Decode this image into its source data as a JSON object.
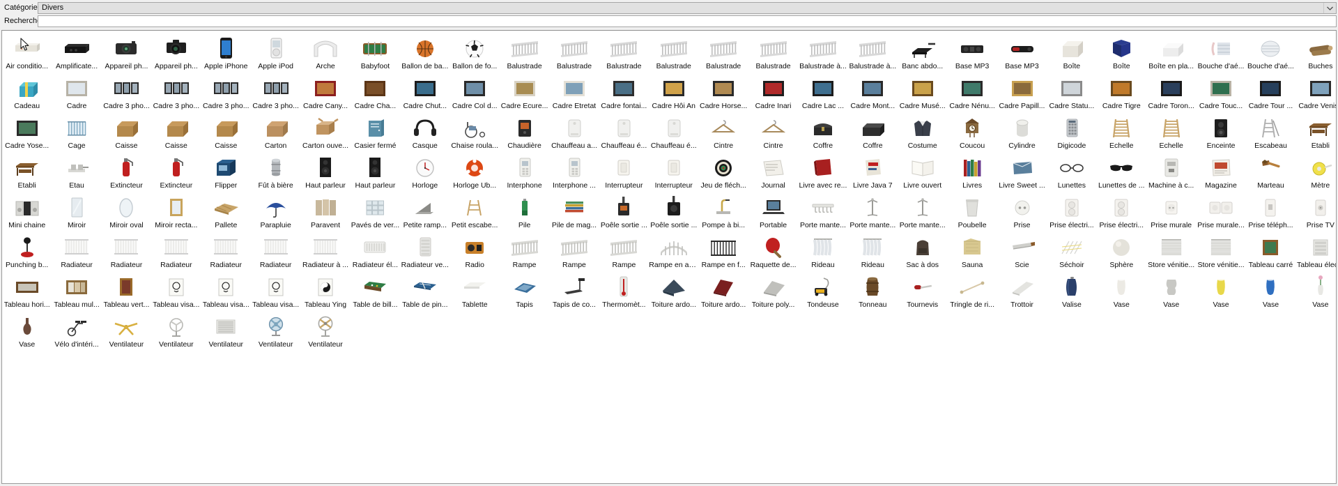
{
  "form": {
    "category_label": "Catégorie:",
    "category_value": "Divers",
    "category_arrow_icon": "chevron-down-icon",
    "search_label": "Recherche:",
    "search_value": "",
    "search_placeholder": ""
  },
  "grid": {
    "columns": 27,
    "items": [
      {
        "label": "Air conditio...",
        "icon": "air-conditioner"
      },
      {
        "label": "Amplificate...",
        "icon": "amplifier"
      },
      {
        "label": "Appareil ph...",
        "icon": "compact-camera"
      },
      {
        "label": "Appareil ph...",
        "icon": "dslr-camera"
      },
      {
        "label": "Apple iPhone",
        "icon": "iphone"
      },
      {
        "label": "Apple iPod",
        "icon": "ipod"
      },
      {
        "label": "Arche",
        "icon": "arch"
      },
      {
        "label": "Babyfoot",
        "icon": "foosball"
      },
      {
        "label": "Ballon de ba...",
        "icon": "basketball"
      },
      {
        "label": "Ballon de fo...",
        "icon": "soccerball"
      },
      {
        "label": "Balustrade",
        "icon": "railing"
      },
      {
        "label": "Balustrade",
        "icon": "railing"
      },
      {
        "label": "Balustrade",
        "icon": "railing"
      },
      {
        "label": "Balustrade",
        "icon": "railing"
      },
      {
        "label": "Balustrade",
        "icon": "railing"
      },
      {
        "label": "Balustrade",
        "icon": "railing"
      },
      {
        "label": "Balustrade à...",
        "icon": "railing"
      },
      {
        "label": "Balustrade à...",
        "icon": "railing"
      },
      {
        "label": "Banc abdo...",
        "icon": "bench"
      },
      {
        "label": "Base MP3",
        "icon": "mp3-dock"
      },
      {
        "label": "Base MP3",
        "icon": "mp3-dock-red"
      },
      {
        "label": "Boîte",
        "icon": "box-white"
      },
      {
        "label": "Boîte",
        "icon": "box-blue"
      },
      {
        "label": "Boîte en pla...",
        "icon": "plastic-box"
      },
      {
        "label": "Bouche d'aé...",
        "icon": "air-vent"
      },
      {
        "label": "Bouche d'aé...",
        "icon": "air-vent-round"
      },
      {
        "label": "Buches",
        "icon": "logs"
      },
      {
        "label": "Cadeau",
        "icon": "gift"
      },
      {
        "label": "Cadre",
        "icon": "frame-plain"
      },
      {
        "label": "Cadre 3 pho...",
        "icon": "frame-triple"
      },
      {
        "label": "Cadre 3 pho...",
        "icon": "frame-triple"
      },
      {
        "label": "Cadre 3 pho...",
        "icon": "frame-triple"
      },
      {
        "label": "Cadre 3 pho...",
        "icon": "frame-triple"
      },
      {
        "label": "Cadre Cany...",
        "icon": "frame-canyon"
      },
      {
        "label": "Cadre Cha...",
        "icon": "frame-brown"
      },
      {
        "label": "Cadre Chut...",
        "icon": "frame-falls"
      },
      {
        "label": "Cadre Col d...",
        "icon": "frame-pass"
      },
      {
        "label": "Cadre Ecure...",
        "icon": "frame-squirrel"
      },
      {
        "label": "Cadre Etretat",
        "icon": "frame-etretat"
      },
      {
        "label": "Cadre fontai...",
        "icon": "frame-fountain"
      },
      {
        "label": "Cadre Hôi An",
        "icon": "frame-hoian"
      },
      {
        "label": "Cadre Horse...",
        "icon": "frame-horse"
      },
      {
        "label": "Cadre Inari",
        "icon": "frame-inari"
      },
      {
        "label": "Cadre Lac ...",
        "icon": "frame-lake"
      },
      {
        "label": "Cadre Mont...",
        "icon": "frame-mountain"
      },
      {
        "label": "Cadre Musé...",
        "icon": "frame-museum"
      },
      {
        "label": "Cadre Nénu...",
        "icon": "frame-lily"
      },
      {
        "label": "Cadre Papill...",
        "icon": "frame-butterfly"
      },
      {
        "label": "Cadre Statu...",
        "icon": "frame-statue"
      },
      {
        "label": "Cadre Tigre",
        "icon": "frame-tiger"
      },
      {
        "label": "Cadre Toron...",
        "icon": "frame-toronto"
      },
      {
        "label": "Cadre Touc...",
        "icon": "frame-toucan"
      },
      {
        "label": "Cadre Tour ...",
        "icon": "frame-tower"
      },
      {
        "label": "Cadre Venise",
        "icon": "frame-venice"
      },
      {
        "label": "Cadre Yose...",
        "icon": "frame-yosemite"
      },
      {
        "label": "Cage",
        "icon": "cage"
      },
      {
        "label": "Caisse",
        "icon": "crate"
      },
      {
        "label": "Caisse",
        "icon": "crate"
      },
      {
        "label": "Caisse",
        "icon": "crate"
      },
      {
        "label": "Carton",
        "icon": "carton"
      },
      {
        "label": "Carton ouve...",
        "icon": "carton-open"
      },
      {
        "label": "Casier fermé",
        "icon": "locker"
      },
      {
        "label": "Casque",
        "icon": "headphones"
      },
      {
        "label": "Chaise roula...",
        "icon": "wheelchair"
      },
      {
        "label": "Chaudière",
        "icon": "boiler"
      },
      {
        "label": "Chauffeau a...",
        "icon": "water-heater"
      },
      {
        "label": "Chauffeau é...",
        "icon": "water-heater"
      },
      {
        "label": "Chauffeau é...",
        "icon": "water-heater"
      },
      {
        "label": "Cintre",
        "icon": "hanger"
      },
      {
        "label": "Cintre",
        "icon": "hanger"
      },
      {
        "label": "Coffre",
        "icon": "chest"
      },
      {
        "label": "Coffre",
        "icon": "chest-dark"
      },
      {
        "label": "Costume",
        "icon": "suit"
      },
      {
        "label": "Coucou",
        "icon": "cuckoo-clock"
      },
      {
        "label": "Cylindre",
        "icon": "cylinder"
      },
      {
        "label": "Digicode",
        "icon": "keypad"
      },
      {
        "label": "Echelle",
        "icon": "ladder"
      },
      {
        "label": "Echelle",
        "icon": "ladder"
      },
      {
        "label": "Enceinte",
        "icon": "speaker"
      },
      {
        "label": "Escabeau",
        "icon": "stepladder"
      },
      {
        "label": "Etabli",
        "icon": "workbench"
      },
      {
        "label": "Etabli",
        "icon": "workbench"
      },
      {
        "label": "Etau",
        "icon": "vise"
      },
      {
        "label": "Extincteur",
        "icon": "extinguisher"
      },
      {
        "label": "Extincteur",
        "icon": "extinguisher"
      },
      {
        "label": "Flipper",
        "icon": "pinball"
      },
      {
        "label": "Fût à bière",
        "icon": "keg"
      },
      {
        "label": "Haut parleur",
        "icon": "loudspeaker"
      },
      {
        "label": "Haut parleur",
        "icon": "loudspeaker"
      },
      {
        "label": "Horloge",
        "icon": "clock"
      },
      {
        "label": "Horloge Ub...",
        "icon": "clock-ubuntu"
      },
      {
        "label": "Interphone",
        "icon": "intercom"
      },
      {
        "label": "Interphone ...",
        "icon": "intercom"
      },
      {
        "label": "Interrupteur",
        "icon": "switch"
      },
      {
        "label": "Interrupteur",
        "icon": "switch"
      },
      {
        "label": "Jeu de fléch...",
        "icon": "darts"
      },
      {
        "label": "Journal",
        "icon": "newspaper"
      },
      {
        "label": "Livre avec re...",
        "icon": "book-red"
      },
      {
        "label": "Livre Java 7",
        "icon": "book-java"
      },
      {
        "label": "Livre ouvert",
        "icon": "book-open"
      },
      {
        "label": "Livres",
        "icon": "books"
      },
      {
        "label": "Livre Sweet ...",
        "icon": "book-sweet"
      },
      {
        "label": "Lunettes",
        "icon": "glasses"
      },
      {
        "label": "Lunettes de ...",
        "icon": "sunglasses"
      },
      {
        "label": "Machine à c...",
        "icon": "coffee-machine"
      },
      {
        "label": "Magazine",
        "icon": "magazine"
      },
      {
        "label": "Marteau",
        "icon": "hammer"
      },
      {
        "label": "Mètre",
        "icon": "tape-measure"
      },
      {
        "label": "Mini chaine",
        "icon": "stereo"
      },
      {
        "label": "Miroir",
        "icon": "mirror"
      },
      {
        "label": "Miroir oval",
        "icon": "mirror-oval"
      },
      {
        "label": "Miroir recta...",
        "icon": "mirror-rect"
      },
      {
        "label": "Pallete",
        "icon": "pallet"
      },
      {
        "label": "Parapluie",
        "icon": "umbrella"
      },
      {
        "label": "Paravent",
        "icon": "screen-divider"
      },
      {
        "label": "Pavés de ver...",
        "icon": "glass-blocks"
      },
      {
        "label": "Petite ramp...",
        "icon": "small-ramp"
      },
      {
        "label": "Petit escabe...",
        "icon": "small-stepladder"
      },
      {
        "label": "Pile",
        "icon": "battery"
      },
      {
        "label": "Pile de mag...",
        "icon": "magazine-stack"
      },
      {
        "label": "Poêle sortie ...",
        "icon": "stove"
      },
      {
        "label": "Poêle sortie ...",
        "icon": "stove-dark"
      },
      {
        "label": "Pompe à bi...",
        "icon": "beer-pump"
      },
      {
        "label": "Portable",
        "icon": "laptop"
      },
      {
        "label": "Porte mante...",
        "icon": "coat-rack-wall"
      },
      {
        "label": "Porte mante...",
        "icon": "coat-rack-stand"
      },
      {
        "label": "Porte mante...",
        "icon": "coat-rack-stand"
      },
      {
        "label": "Poubelle",
        "icon": "trash-bin"
      },
      {
        "label": "Prise",
        "icon": "socket"
      },
      {
        "label": "Prise électri...",
        "icon": "power-socket"
      },
      {
        "label": "Prise électri...",
        "icon": "power-socket"
      },
      {
        "label": "Prise murale",
        "icon": "wall-socket"
      },
      {
        "label": "Prise murale...",
        "icon": "wall-socket-double"
      },
      {
        "label": "Prise téléph...",
        "icon": "phone-socket"
      },
      {
        "label": "Prise TV",
        "icon": "tv-socket"
      },
      {
        "label": "Punching b...",
        "icon": "punching-ball"
      },
      {
        "label": "Radiateur",
        "icon": "radiator"
      },
      {
        "label": "Radiateur",
        "icon": "radiator"
      },
      {
        "label": "Radiateur",
        "icon": "radiator"
      },
      {
        "label": "Radiateur",
        "icon": "radiator"
      },
      {
        "label": "Radiateur",
        "icon": "radiator"
      },
      {
        "label": "Radiateur à ...",
        "icon": "radiator"
      },
      {
        "label": "Radiateur él...",
        "icon": "radiator-electric"
      },
      {
        "label": "Radiateur ve...",
        "icon": "radiator-vertical"
      },
      {
        "label": "Radio",
        "icon": "radio"
      },
      {
        "label": "Rampe",
        "icon": "ramp-rail"
      },
      {
        "label": "Rampe",
        "icon": "ramp-rail"
      },
      {
        "label": "Rampe",
        "icon": "ramp-rail"
      },
      {
        "label": "Rampe en an...",
        "icon": "ramp-curved"
      },
      {
        "label": "Rampe en f...",
        "icon": "ramp-iron"
      },
      {
        "label": "Raquette de...",
        "icon": "ping-pong-paddle"
      },
      {
        "label": "Rideau",
        "icon": "curtain"
      },
      {
        "label": "Rideau",
        "icon": "curtain"
      },
      {
        "label": "Sac à dos",
        "icon": "backpack"
      },
      {
        "label": "Sauna",
        "icon": "sauna"
      },
      {
        "label": "Scie",
        "icon": "saw"
      },
      {
        "label": "Séchoir",
        "icon": "drying-rack"
      },
      {
        "label": "Sphère",
        "icon": "sphere"
      },
      {
        "label": "Store vénitie...",
        "icon": "venetian-blind"
      },
      {
        "label": "Store vénitie...",
        "icon": "venetian-blind"
      },
      {
        "label": "Tableau carré",
        "icon": "painting-square"
      },
      {
        "label": "Tableau élec...",
        "icon": "electrical-panel"
      },
      {
        "label": "Tableau hori...",
        "icon": "painting-horizontal"
      },
      {
        "label": "Tableau mul...",
        "icon": "painting-multi"
      },
      {
        "label": "Tableau vert...",
        "icon": "painting-vertical"
      },
      {
        "label": "Tableau visa...",
        "icon": "painting-face"
      },
      {
        "label": "Tableau visa...",
        "icon": "painting-face"
      },
      {
        "label": "Tableau visa...",
        "icon": "painting-face"
      },
      {
        "label": "Tableau Ying",
        "icon": "painting-yinyang"
      },
      {
        "label": "Table de bill...",
        "icon": "pool-table"
      },
      {
        "label": "Table de pin...",
        "icon": "ping-pong-table"
      },
      {
        "label": "Tablette",
        "icon": "shelf"
      },
      {
        "label": "Tapis",
        "icon": "rug"
      },
      {
        "label": "Tapis de co...",
        "icon": "treadmill"
      },
      {
        "label": "Thermomèt...",
        "icon": "thermometer"
      },
      {
        "label": "Toiture ardo...",
        "icon": "roof-slate"
      },
      {
        "label": "Toiture ardo...",
        "icon": "roof-slate-red"
      },
      {
        "label": "Toiture poly...",
        "icon": "roof-poly"
      },
      {
        "label": "Tondeuse",
        "icon": "lawnmower"
      },
      {
        "label": "Tonneau",
        "icon": "barrel"
      },
      {
        "label": "Tournevis",
        "icon": "screwdriver"
      },
      {
        "label": "Tringle de ri...",
        "icon": "curtain-rod"
      },
      {
        "label": "Trottoir",
        "icon": "sidewalk"
      },
      {
        "label": "Valise",
        "icon": "suitcase"
      },
      {
        "label": "Vase",
        "icon": "vase-white"
      },
      {
        "label": "Vase",
        "icon": "vase-grey"
      },
      {
        "label": "Vase",
        "icon": "vase-yellow"
      },
      {
        "label": "Vase",
        "icon": "vase-blue"
      },
      {
        "label": "Vase",
        "icon": "vase-flower"
      },
      {
        "label": "Vase",
        "icon": "vase-dark"
      },
      {
        "label": "Vélo d'intéri...",
        "icon": "exercise-bike"
      },
      {
        "label": "Ventilateur",
        "icon": "ceiling-fan"
      },
      {
        "label": "Ventilateur",
        "icon": "floor-fan"
      },
      {
        "label": "Ventilateur",
        "icon": "vent-grille"
      },
      {
        "label": "Ventilateur",
        "icon": "desk-fan"
      },
      {
        "label": "Ventilateur",
        "icon": "standing-fan"
      }
    ]
  },
  "colors": {
    "window_bg": "#f0f0f0",
    "field_border": "#a6a6a6",
    "combo_bg": "#e1e1e1",
    "panel_bg": "#ffffff",
    "text": "#0d0d0d"
  }
}
